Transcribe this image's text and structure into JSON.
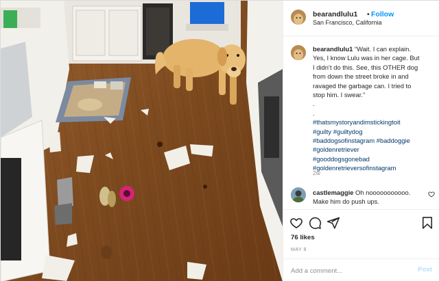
{
  "post": {
    "username": "bearandlulu1",
    "follow_label": "Follow",
    "location": "San Francisco, California",
    "photo_alt": "Golden retriever standing in a kitchen with scattered garbage on the wood floor"
  },
  "caption": {
    "username": "bearandlulu1",
    "lines": [
      "“Wait. I can explain.",
      "Yes, I know Lulu was in her cage. But",
      "I didn’t do this. See, this OTHER dog",
      "from down the street broke in and",
      "ravaged the garbage can. I tried to",
      "stop him. I swear.”",
      ".",
      "."
    ],
    "hashtags": [
      "#thatsmystoryandimstickingtoit",
      "#guilty #guiltydog",
      "#baddogsofinstagram #baddoggie",
      "#goldenretriever",
      "#gooddogsgonebad",
      "#goldenretrieversofinstagram"
    ],
    "time": "2w"
  },
  "comment": {
    "username": "castlemaggie",
    "text_line1": "Oh nooooooooooo.",
    "text_line2": "Make him do push ups."
  },
  "actions": {
    "likes": "76 likes",
    "date": "MAY 8",
    "icons": [
      "heart-icon",
      "comment-icon",
      "share-icon",
      "bookmark-icon"
    ]
  },
  "add_comment": {
    "placeholder": "Add a comment...",
    "post_label": "Post"
  },
  "colors": {
    "link_blue": "#0095f6",
    "hashtag": "#00376b",
    "muted": "#8e8e8e",
    "post_disabled": "#b2dffc",
    "floor": "#8a5428"
  }
}
